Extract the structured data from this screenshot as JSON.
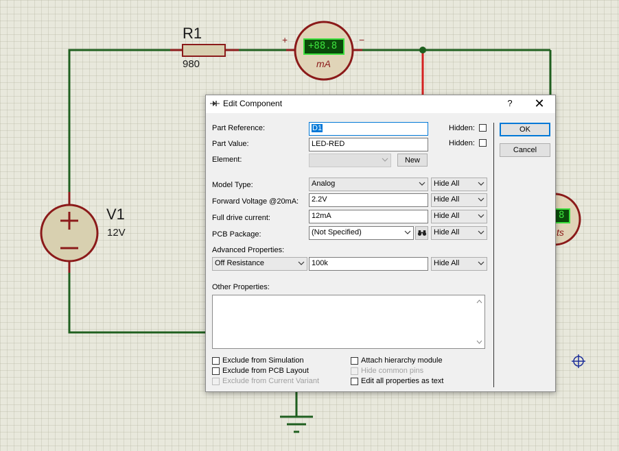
{
  "schematic": {
    "r1": {
      "ref": "R1",
      "value": "980"
    },
    "v1": {
      "ref": "V1",
      "value": "12V"
    },
    "ammeter": {
      "display": "+88.8",
      "unit": "mA",
      "plus": "+",
      "minus": "−"
    },
    "voltmeter": {
      "display": "8",
      "unit": "ts"
    },
    "colors": {
      "wire": "#1f5f1f",
      "wire_red": "#d42020",
      "meter_border": "#8b1a1a",
      "meter_fill": "#e0d4b8",
      "lcd_bg": "#0a4a0a",
      "lcd_fg": "#3de03d",
      "source_fill": "#d8d0b0"
    }
  },
  "dialog": {
    "title": "Edit Component",
    "help": "?",
    "close": "✕",
    "fields": {
      "part_reference_label": "Part Reference:",
      "part_reference_value": "D1",
      "part_value_label": "Part Value:",
      "part_value_value": "LED-RED",
      "element_label": "Element:",
      "new_button": "New",
      "hidden_label_1": "Hidden:",
      "hidden_label_2": "Hidden:"
    },
    "properties": [
      {
        "label": "Model Type:",
        "value": "Analog",
        "type": "combo",
        "visibility": "Hide All"
      },
      {
        "label": "Forward Voltage @20mA:",
        "value": "2.2V",
        "type": "text",
        "visibility": "Hide All"
      },
      {
        "label": "Full drive current:",
        "value": "12mA",
        "type": "text",
        "visibility": "Hide All"
      },
      {
        "label": "PCB Package:",
        "value": "(Not Specified)",
        "type": "combo",
        "visibility": "Hide All"
      }
    ],
    "advanced": {
      "label": "Advanced Properties:",
      "property": "Off Resistance",
      "value": "100k",
      "visibility": "Hide All"
    },
    "other_properties_label": "Other Properties:",
    "checkboxes": {
      "exclude_simulation": "Exclude from Simulation",
      "exclude_pcb": "Exclude from PCB Layout",
      "exclude_variant": "Exclude from Current Variant",
      "attach_hierarchy": "Attach hierarchy module",
      "hide_common_pins": "Hide common pins",
      "edit_all_text": "Edit all properties as text"
    },
    "buttons": {
      "ok": "OK",
      "cancel": "Cancel"
    }
  }
}
